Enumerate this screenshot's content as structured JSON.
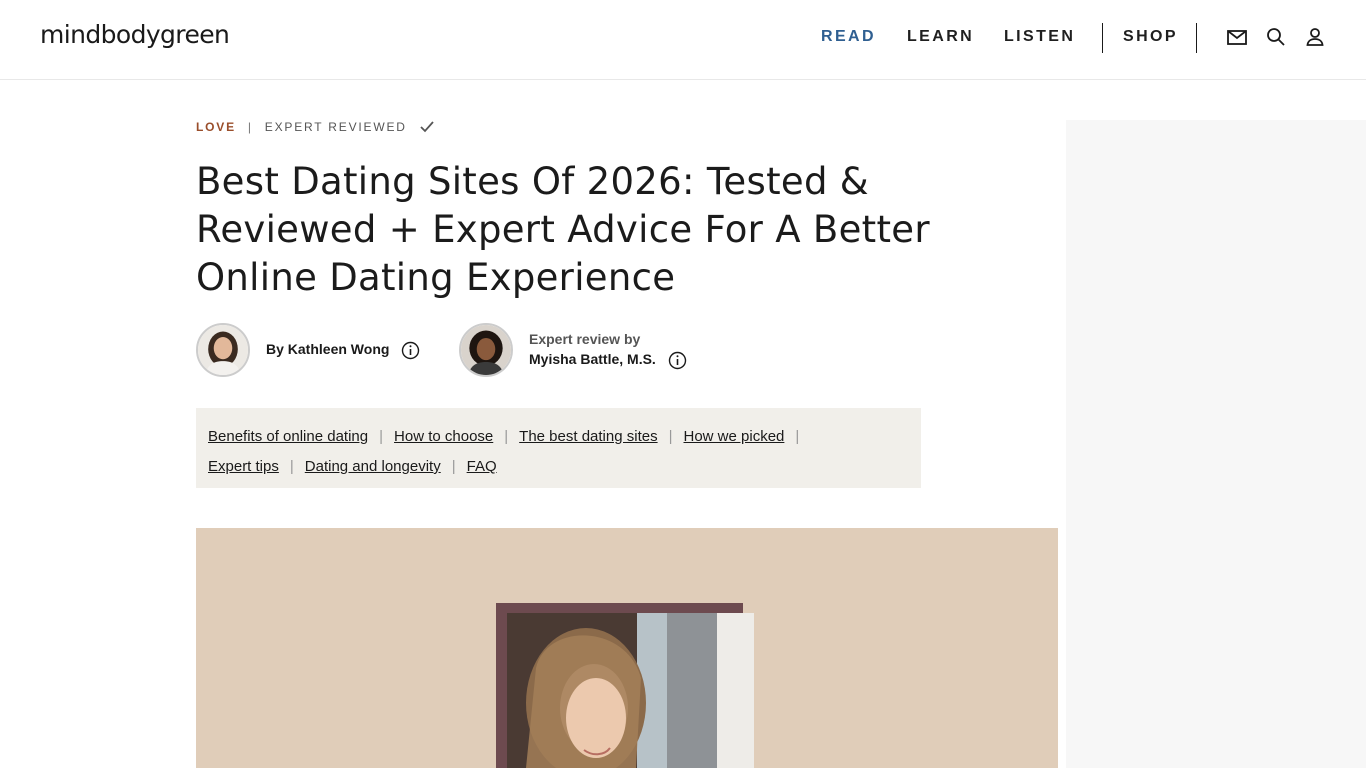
{
  "header": {
    "logo": "mindbodygreen",
    "nav": [
      {
        "label": "READ"
      },
      {
        "label": "LEARN"
      },
      {
        "label": "LISTEN"
      },
      {
        "label": "SHOP"
      }
    ],
    "icons": [
      "mail-icon",
      "search-icon",
      "user-icon"
    ],
    "accent_color": "#2f5f91"
  },
  "article": {
    "category": "LOVE",
    "separator": "|",
    "badge": "EXPERT REVIEWED",
    "title": "Best Dating Sites Of 2026: Tested & Reviewed + Expert Advice For A Better Online Dating Experience",
    "author": {
      "byline": "By Kathleen Wong"
    },
    "reviewer": {
      "label": "Expert review by",
      "name": "Myisha Battle, M.S."
    },
    "toc": [
      "Benefits of online dating",
      "How to choose",
      "The best dating sites",
      "How we picked",
      "Expert tips",
      "Dating and longevity",
      "FAQ"
    ],
    "toc_separator": "|",
    "category_color": "#9a4e2b",
    "hero_background": "#e0cdb9"
  }
}
